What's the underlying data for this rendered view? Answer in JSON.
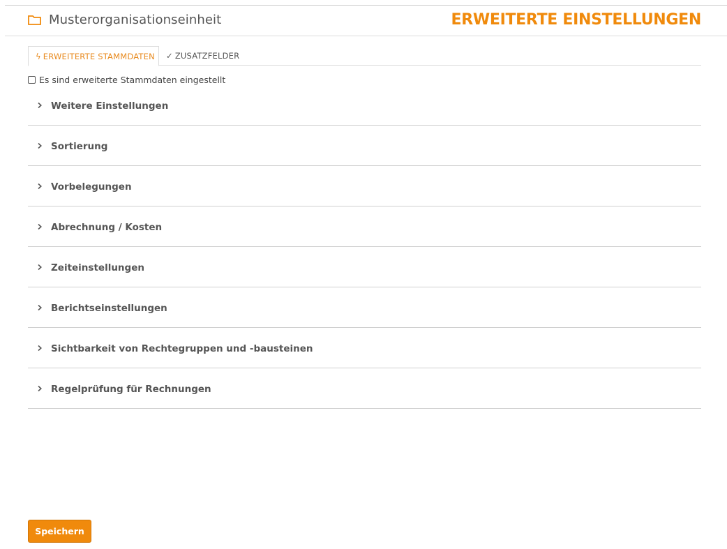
{
  "header": {
    "icon": "folder-icon",
    "org_name": "Musterorganisationseinheit",
    "title": "ERWEITERTE EINSTELLUNGEN"
  },
  "tabs": [
    {
      "mark": "ϟ",
      "label": "ERWEITERTE STAMMDATEN",
      "active": true
    },
    {
      "mark": "✓",
      "label": "ZUSATZFELDER",
      "active": false
    }
  ],
  "checkbox": {
    "label": "Es sind erweiterte Stammdaten eingestellt",
    "checked": false
  },
  "sections": [
    {
      "label": "Weitere Einstellungen"
    },
    {
      "label": "Sortierung"
    },
    {
      "label": "Vorbelegungen"
    },
    {
      "label": "Abrechnung / Kosten"
    },
    {
      "label": "Zeiteinstellungen"
    },
    {
      "label": "Berichtseinstellungen"
    },
    {
      "label": "Sichtbarkeit von Rechtegruppen und -bausteinen"
    },
    {
      "label": "Regelprüfung für Rechnungen"
    }
  ],
  "footer": {
    "save_label": "Speichern"
  },
  "colors": {
    "accent": "#f08a0c",
    "text": "#555555",
    "divider": "#cfcfcf"
  }
}
